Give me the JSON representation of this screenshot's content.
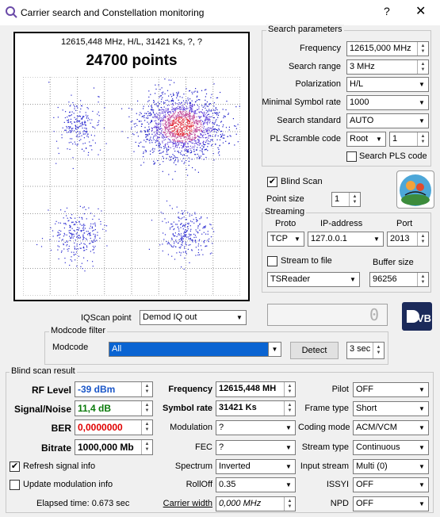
{
  "window": {
    "title": "Carrier search and Constellation monitoring",
    "help": "?",
    "close": "✕"
  },
  "constellation": {
    "info": "12615,448 MHz, H/L, 31421 Ks, ?, ?",
    "points": "24700 points"
  },
  "search": {
    "group": "Search parameters",
    "frequency_label": "Frequency",
    "frequency": "12615,000 MHz",
    "range_label": "Search range",
    "range": "3 MHz",
    "polarization_label": "Polarization",
    "polarization": "H/L",
    "minsr_label": "Minimal Symbol rate",
    "minsr": "1000",
    "standard_label": "Search standard",
    "standard": "AUTO",
    "pls_label": "PL Scramble code",
    "pls_mode": "Root",
    "pls_code": "1",
    "search_pls": "Search PLS code"
  },
  "blindscan": {
    "label": "Blind Scan",
    "point_size_label": "Point size",
    "point_size": "1"
  },
  "streaming": {
    "group": "Streaming",
    "proto_label": "Proto",
    "ip_label": "IP-address",
    "port_label": "Port",
    "proto": "TCP",
    "ip": "127.0.0.1",
    "port": "2013",
    "stream_to_file": "Stream to file",
    "buffer_label": "Buffer size",
    "player": "TSReader",
    "buffer": "96256"
  },
  "iq": {
    "label": "IQScan point",
    "value": "Demod IQ out",
    "display": "0"
  },
  "modcode": {
    "group": "Modcode filter",
    "label": "Modcode",
    "value": "All",
    "detect": "Detect",
    "timeout": "3 sec"
  },
  "result": {
    "group": "Blind scan result",
    "rf_label": "RF Level",
    "rf": "-39 dBm",
    "sn_label": "Signal/Noise",
    "sn": "11,4 dB",
    "ber_label": "BER",
    "ber": "0,0000000",
    "bitrate_label": "Bitrate",
    "bitrate": "1000,000 Mb",
    "freq_label": "Frequency",
    "freq": "12615,448 MH",
    "sr_label": "Symbol rate",
    "sr": "31421 Ks",
    "mod_label": "Modulation",
    "mod": "?",
    "fec_label": "FEC",
    "fec": "?",
    "spectrum_label": "Spectrum",
    "spectrum": "Inverted",
    "rolloff_label": "RollOff",
    "rolloff": "0.35",
    "cw_label": "Carrier width",
    "cw": "0,000 MHz",
    "pilot_label": "Pilot",
    "pilot": "OFF",
    "frame_label": "Frame type",
    "frame": "Short",
    "coding_label": "Coding mode",
    "coding": "ACM/VCM",
    "stype_label": "Stream type",
    "stype": "Continuous",
    "istream_label": "Input stream",
    "istream": "Multi (0)",
    "issyi_label": "ISSYI",
    "issyi": "OFF",
    "npd_label": "NPD",
    "npd": "OFF",
    "refresh_label": "Refresh signal info",
    "update_label": "Update modulation info",
    "elapsed": "Elapsed time: 0.673 sec"
  },
  "colors": {
    "rf": "#1a56c8",
    "sn": "#0a7a0a",
    "ber": "#e00000",
    "selection": "#0a64d2"
  }
}
